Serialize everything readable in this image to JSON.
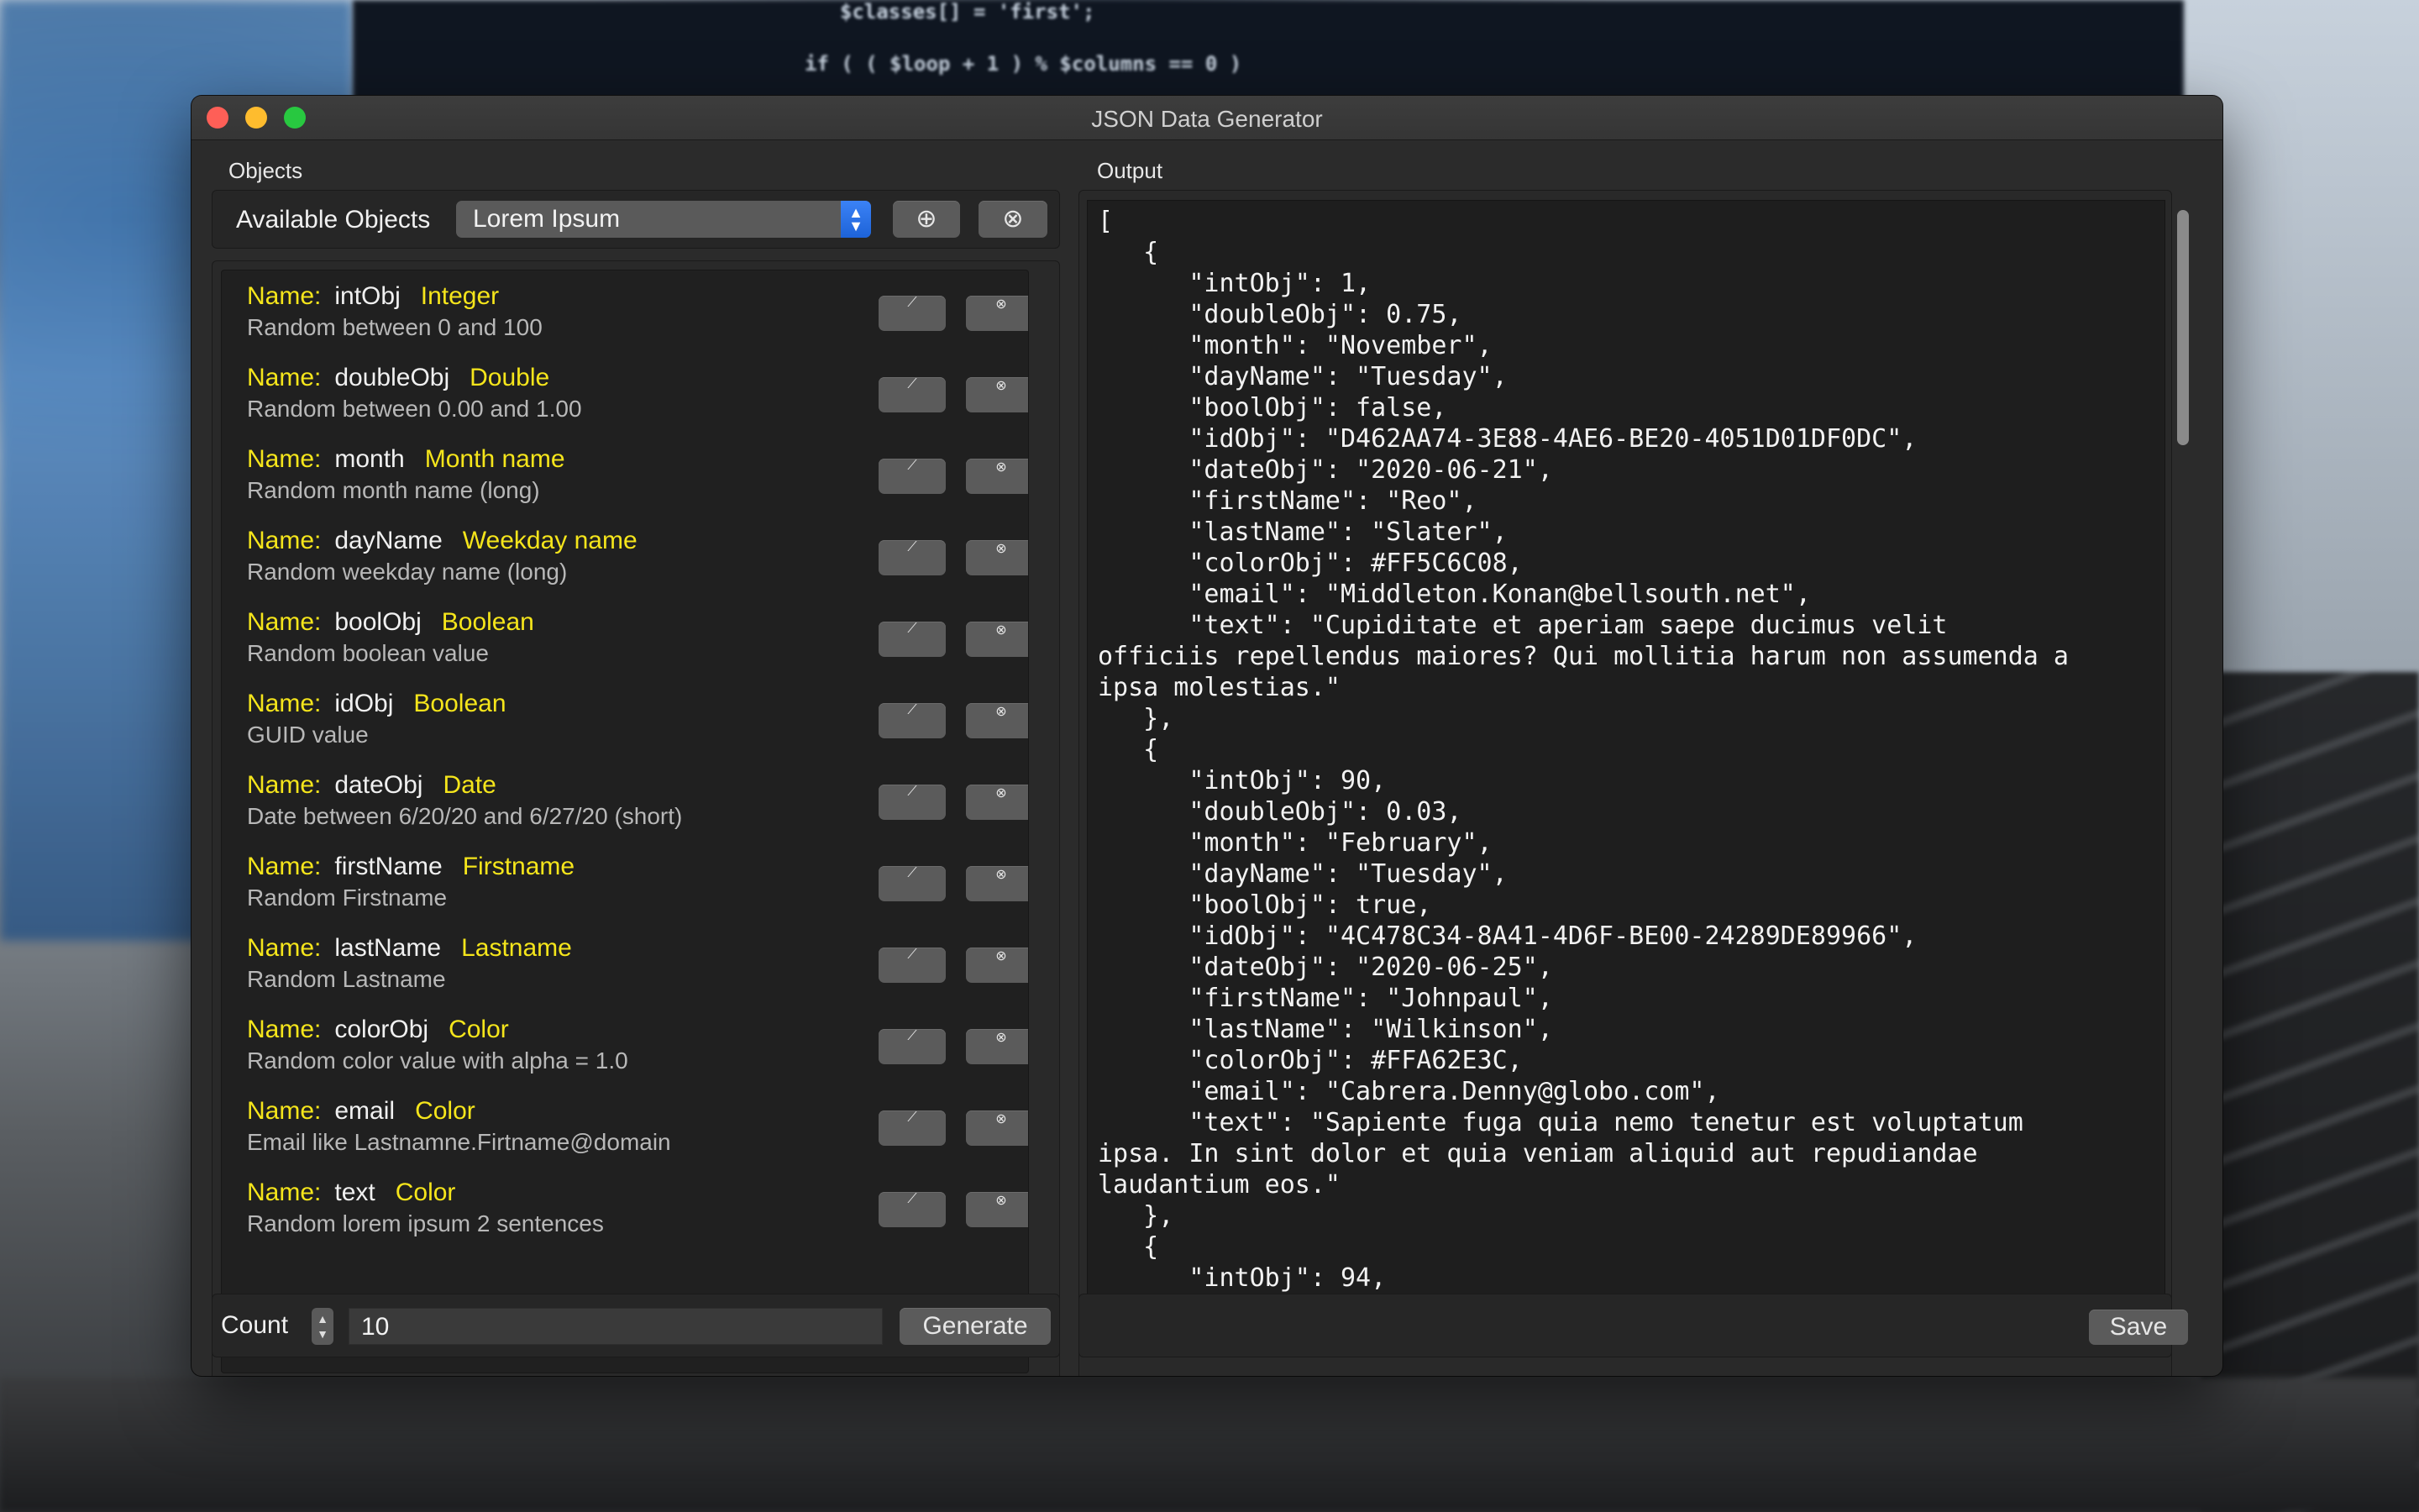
{
  "window": {
    "title": "JSON Data Generator"
  },
  "background_code": [
    "$classes[] = 'first';",
    "if ( ( $loop + 1 ) % $columns == 0 )"
  ],
  "objects_panel": {
    "label": "Objects",
    "available_label": "Available Objects",
    "selected_object": "Lorem Ipsum",
    "add_icon": "⊕",
    "remove_icon": "⊗",
    "items": [
      {
        "label": "Name:",
        "name": "intObj",
        "type": "Integer",
        "description": "Random between 0 and 100"
      },
      {
        "label": "Name:",
        "name": "doubleObj",
        "type": "Double",
        "description": "Random between 0.00 and 1.00"
      },
      {
        "label": "Name:",
        "name": "month",
        "type": "Month name",
        "description": "Random month name (long)"
      },
      {
        "label": "Name:",
        "name": "dayName",
        "type": "Weekday name",
        "description": "Random weekday name (long)"
      },
      {
        "label": "Name:",
        "name": "boolObj",
        "type": "Boolean",
        "description": "Random boolean value"
      },
      {
        "label": "Name:",
        "name": "idObj",
        "type": "Boolean",
        "description": "GUID value"
      },
      {
        "label": "Name:",
        "name": "dateObj",
        "type": "Date",
        "description": "Date between 6/20/20 and 6/27/20 (short)"
      },
      {
        "label": "Name:",
        "name": "firstName",
        "type": "Firstname",
        "description": "Random Firstname"
      },
      {
        "label": "Name:",
        "name": "lastName",
        "type": "Lastname",
        "description": "Random Lastname"
      },
      {
        "label": "Name:",
        "name": "colorObj",
        "type": "Color",
        "description": "Random color value with alpha = 1.0"
      },
      {
        "label": "Name:",
        "name": "email",
        "type": "Color",
        "description": "Email like  Lastnamne.Firtname@domain"
      },
      {
        "label": "Name:",
        "name": "text",
        "type": "Color",
        "description": "Random lorem ipsum 2 sentences"
      }
    ],
    "edit_icon": "⟋",
    "delete_icon": "⊗",
    "count_label": "Count",
    "count_value": "10",
    "generate_label": "Generate"
  },
  "output_panel": {
    "label": "Output",
    "lines": [
      "[",
      "   {",
      "      \"intObj\": 1,",
      "      \"doubleObj\": 0.75,",
      "      \"month\": \"November\",",
      "      \"dayName\": \"Tuesday\",",
      "      \"boolObj\": false,",
      "      \"idObj\": \"D462AA74-3E88-4AE6-BE20-4051D01DF0DC\",",
      "      \"dateObj\": \"2020-06-21\",",
      "      \"firstName\": \"Reo\",",
      "      \"lastName\": \"Slater\",",
      "      \"colorObj\": #FF5C6C08,",
      "      \"email\": \"Middleton.Konan@bellsouth.net\",",
      "      \"text\": \"Cupiditate et aperiam saepe ducimus velit",
      "officiis repellendus maiores? Qui mollitia harum non assumenda a",
      "ipsa molestias.\"",
      "   },",
      "   {",
      "      \"intObj\": 90,",
      "      \"doubleObj\": 0.03,",
      "      \"month\": \"February\",",
      "      \"dayName\": \"Tuesday\",",
      "      \"boolObj\": true,",
      "      \"idObj\": \"4C478C34-8A41-4D6F-BE00-24289DE89966\",",
      "      \"dateObj\": \"2020-06-25\",",
      "      \"firstName\": \"Johnpaul\",",
      "      \"lastName\": \"Wilkinson\",",
      "      \"colorObj\": #FFA62E3C,",
      "      \"email\": \"Cabrera.Denny@globo.com\",",
      "      \"text\": \"Sapiente fuga quia nemo tenetur est voluptatum",
      "ipsa. In sint dolor et quia veniam aliquid aut repudiandae",
      "laudantium eos.\"",
      "   },",
      "   {",
      "      \"intObj\": 94,"
    ],
    "save_label": "Save"
  }
}
